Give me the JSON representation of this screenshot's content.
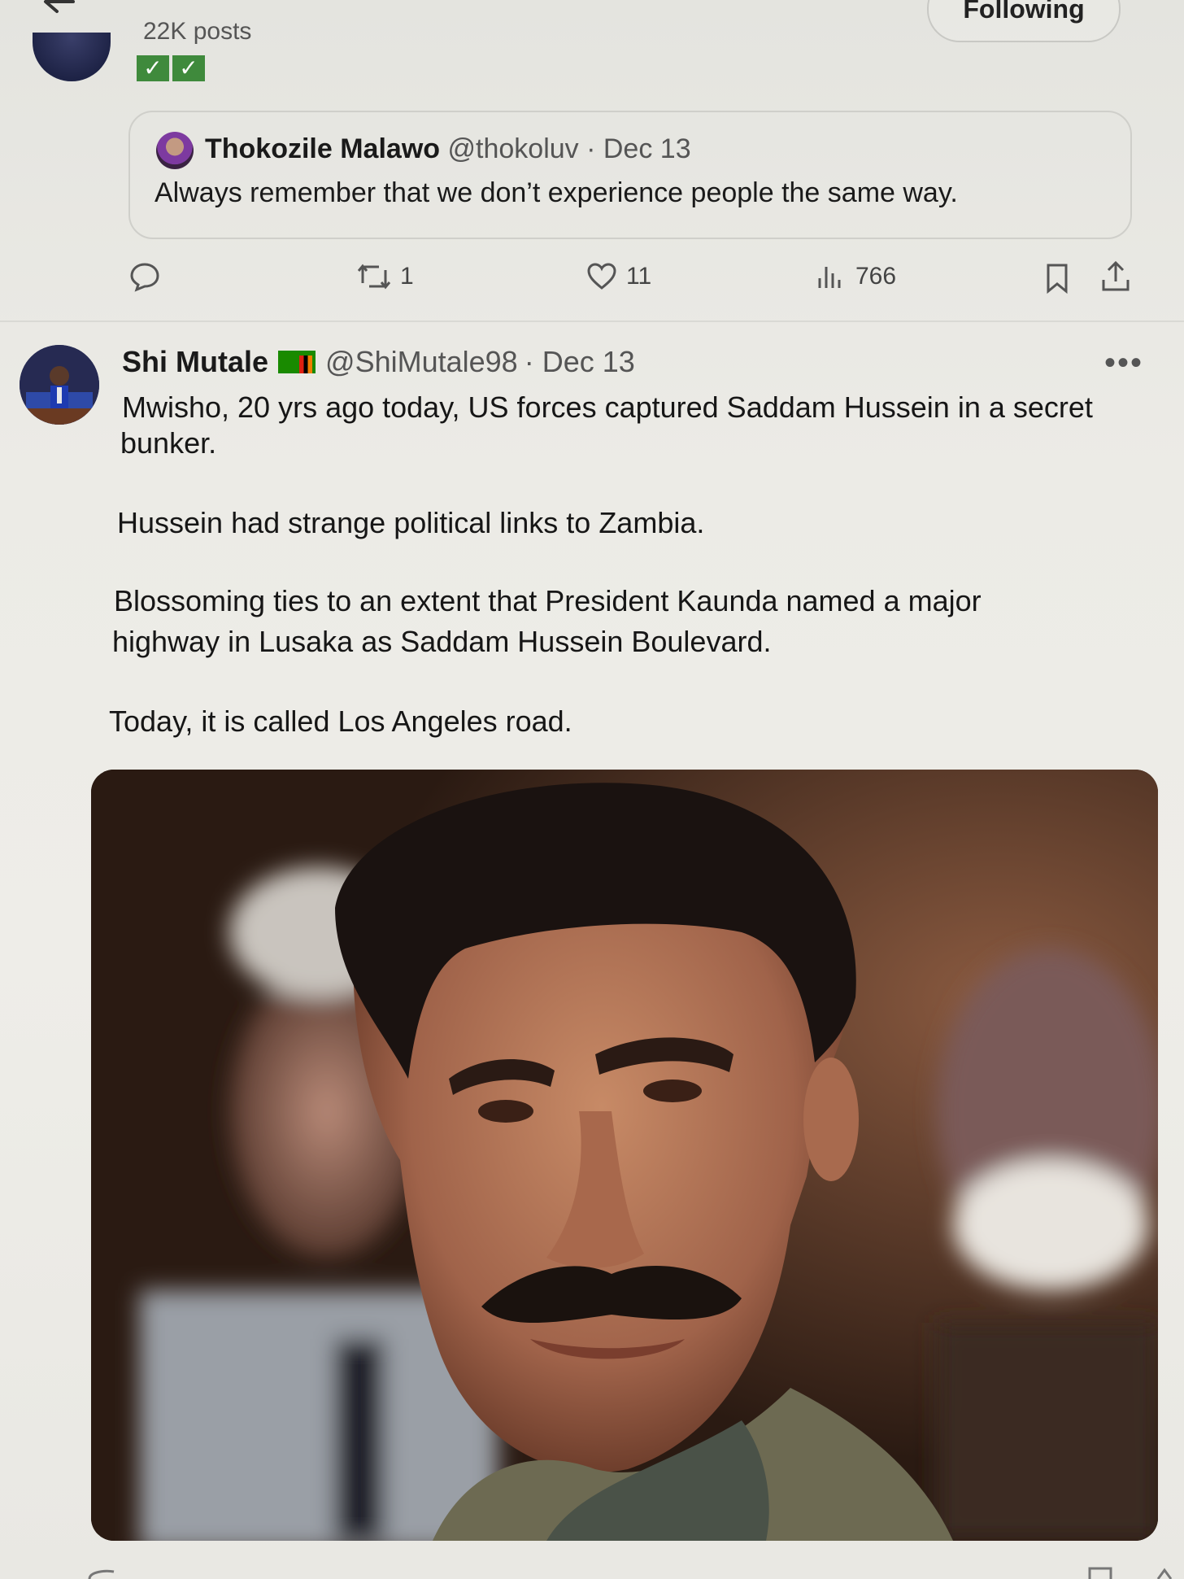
{
  "header": {
    "posts_count": "22K posts",
    "follow_button": "Following",
    "badge_1": "✓",
    "badge_2": "✓"
  },
  "quoted_tweet": {
    "name": "Thokozile Malawo",
    "handle": "@thokoluv",
    "date": "· Dec 13",
    "text": "Always remember that we don’t experience people the same way."
  },
  "actions": {
    "retweets": "1",
    "likes": "11",
    "views": "766"
  },
  "main_tweet": {
    "name": "Shi Mutale",
    "handle": "@ShiMutale98",
    "date": "· Dec 13",
    "more": "•••",
    "lines": [
      "Mwisho, 20 yrs ago today, US forces captured Saddam Hussein in a secret",
      "bunker.",
      "Hussein had strange political links to Zambia.",
      "Blossoming ties to an extent that President Kaunda named a major",
      "highway in Lusaka as Saddam Hussein Boulevard.",
      "Today, it is called Los Angeles road."
    ]
  },
  "colors": {
    "background": "#ecebe6",
    "badge_green": "#3f8a3c",
    "text": "#161616",
    "muted": "#555555"
  }
}
